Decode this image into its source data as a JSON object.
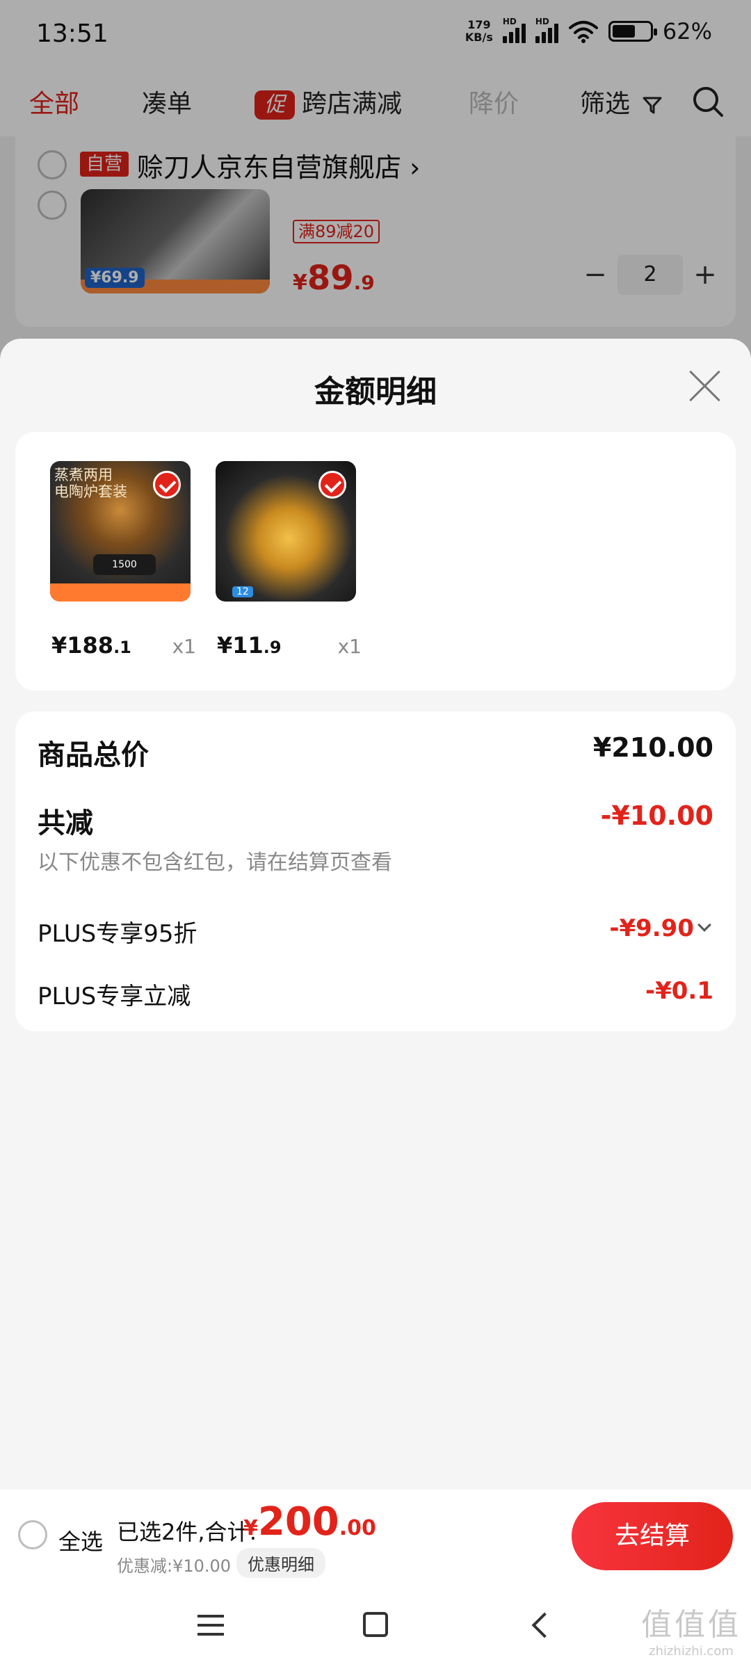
{
  "status_bar": {
    "time": "13:51",
    "net_speed_value": "179",
    "net_speed_unit": "KB/s",
    "signal_1_label": "HD",
    "signal_2_label": "HD",
    "battery_percent": "62%",
    "battery_level": 0.62
  },
  "filters": {
    "all": "全部",
    "bundle": "凑单",
    "promo_badge": "促",
    "cross_store": "跨店满减",
    "price_drop": "降价",
    "filter": "筛选"
  },
  "cart_item": {
    "shop_badge": "自营",
    "shop_name": "赊刀人京东自营旗舰店",
    "image_price": "¥69.9",
    "coupon": "满89减20",
    "price_symbol": "¥",
    "price_int": "89",
    "price_dec": ".9",
    "quantity": "2",
    "minus": "−",
    "plus": "+"
  },
  "sheet": {
    "title": "金额明细",
    "items": [
      {
        "image_title": "蒸煮两用\n电陶炉套装",
        "stove_display": "1500",
        "price_symbol": "¥",
        "price_int": "188",
        "price_dec": ".1",
        "qty": "x1"
      },
      {
        "image_chip": "12",
        "price_symbol": "¥",
        "price_int": "11",
        "price_dec": ".9",
        "qty": "x1"
      }
    ],
    "summary": {
      "total_label": "商品总价",
      "total_value": "¥210.00",
      "discount_label": "共减",
      "discount_value": "-¥10.00",
      "note": "以下优惠不包含红包，请在结算页查看",
      "plus_discount_label": "PLUS专享95折",
      "plus_discount_value": "-¥9.90",
      "plus_reduce_label": "PLUS专享立减",
      "plus_reduce_value": "-¥0.1"
    }
  },
  "checkout": {
    "select_all": "全选",
    "selected_text": "已选2件,合计:",
    "sum_symbol": "¥",
    "sum_int": "200",
    "sum_dec": ".00",
    "savings": "优惠减:¥10.00",
    "detail_button": "优惠明细",
    "checkout_button": "去结算"
  },
  "watermark": {
    "logo": "值值值",
    "url": "zhizhizhi.com"
  },
  "colors": {
    "accent": "#e2231a",
    "muted": "#888888"
  }
}
